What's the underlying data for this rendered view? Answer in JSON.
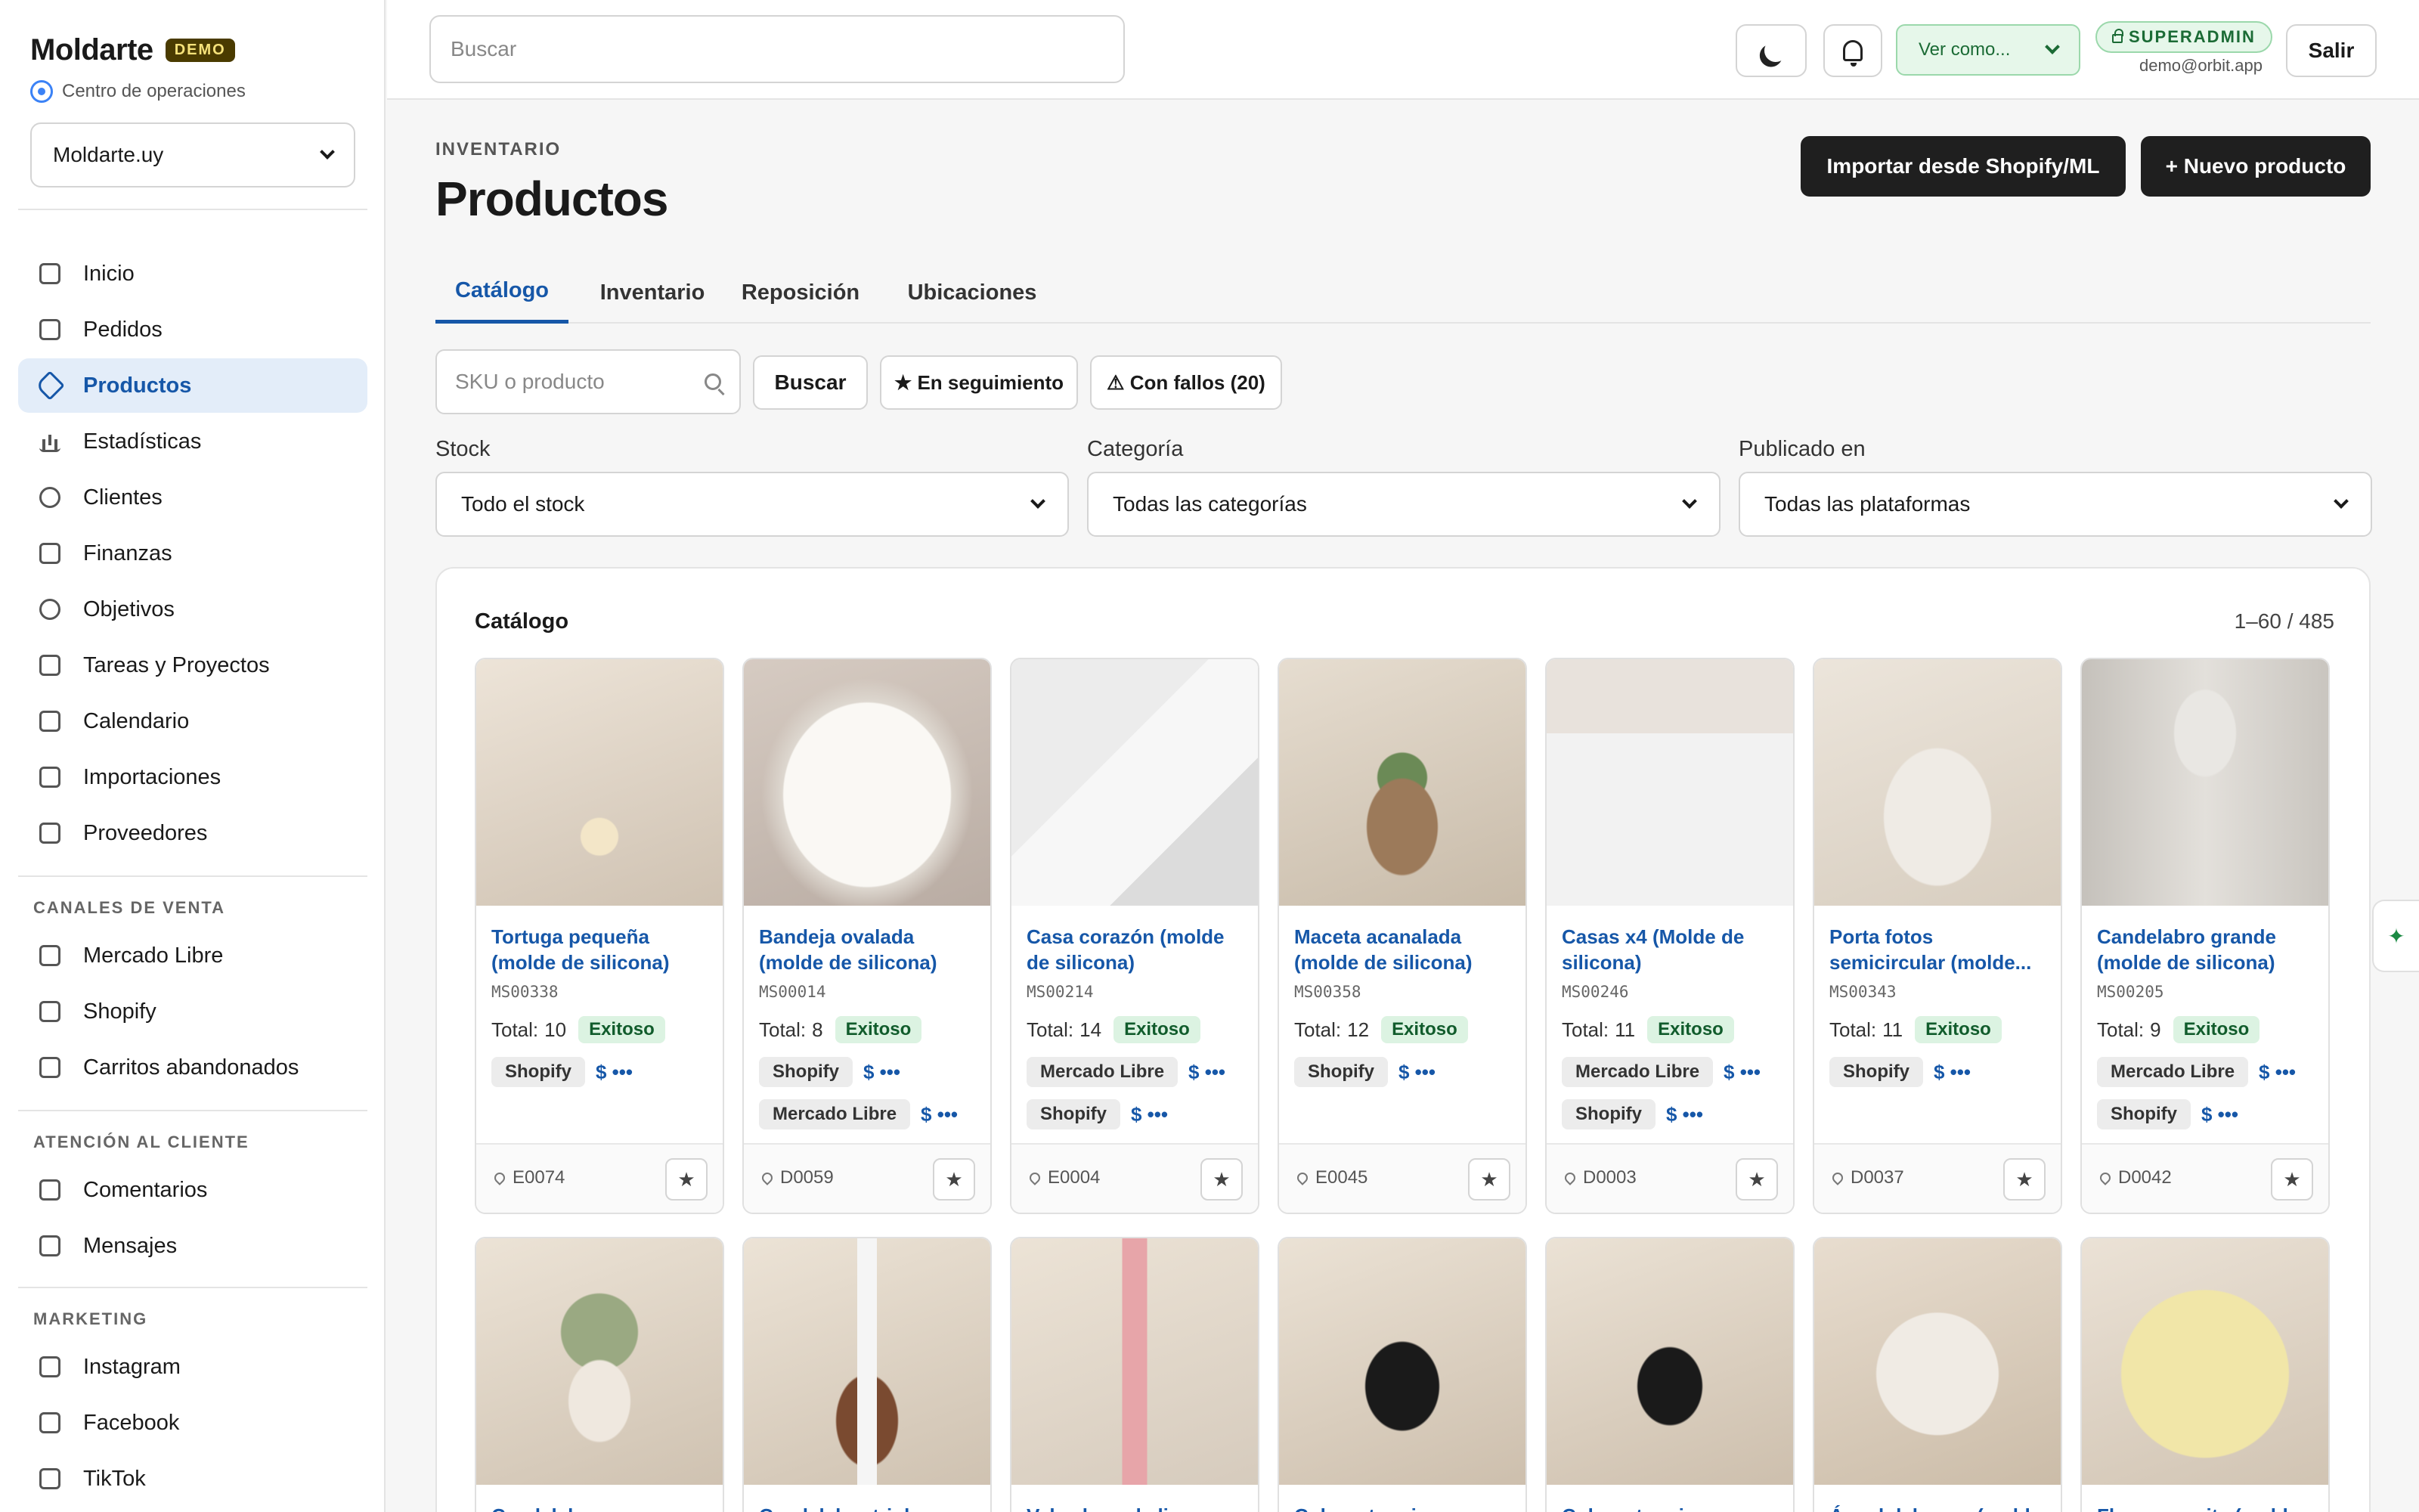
{
  "brand": {
    "name": "Moldarte",
    "badge": "DEMO",
    "subtitle": "Centro de operaciones",
    "store": "Moldarte.uy"
  },
  "sidebar": {
    "main": [
      {
        "label": "Inicio",
        "icon": "home-icon"
      },
      {
        "label": "Pedidos",
        "icon": "inbox-icon"
      },
      {
        "label": "Productos",
        "icon": "tag-icon",
        "active": true
      },
      {
        "label": "Estadísticas",
        "icon": "bar-chart-icon"
      },
      {
        "label": "Clientes",
        "icon": "user-icon"
      },
      {
        "label": "Finanzas",
        "icon": "wallet-icon"
      },
      {
        "label": "Objetivos",
        "icon": "target-icon"
      },
      {
        "label": "Tareas y Proyectos",
        "icon": "clipboard-icon"
      },
      {
        "label": "Calendario",
        "icon": "calendar-icon"
      },
      {
        "label": "Importaciones",
        "icon": "import-icon"
      },
      {
        "label": "Proveedores",
        "icon": "supplier-icon"
      }
    ],
    "sections": [
      {
        "title": "CANALES DE VENTA",
        "items": [
          {
            "label": "Mercado Libre",
            "icon": "store-icon"
          },
          {
            "label": "Shopify",
            "icon": "store-icon"
          },
          {
            "label": "Carritos abandonados",
            "icon": "inbox-icon"
          }
        ]
      },
      {
        "title": "ATENCIÓN AL CLIENTE",
        "items": [
          {
            "label": "Comentarios",
            "icon": "chat-icon"
          },
          {
            "label": "Mensajes",
            "icon": "chat-icon"
          }
        ]
      },
      {
        "title": "MARKETING",
        "items": [
          {
            "label": "Instagram",
            "icon": "store-icon"
          },
          {
            "label": "Facebook",
            "icon": "store-icon"
          },
          {
            "label": "TikTok",
            "icon": "store-icon"
          }
        ]
      }
    ]
  },
  "topbar": {
    "search_placeholder": "Buscar",
    "view_as": "Ver como...",
    "role": "SUPERADMIN",
    "email": "demo@orbit.app",
    "logout": "Salir"
  },
  "page": {
    "eyebrow": "INVENTARIO",
    "title": "Productos",
    "import_button": "Importar desde Shopify/ML",
    "new_button": "+ Nuevo producto",
    "tabs": [
      {
        "label": "Catálogo",
        "active": true
      },
      {
        "label": "Inventario"
      },
      {
        "label": "Reposición"
      },
      {
        "label": "Ubicaciones"
      }
    ]
  },
  "filters": {
    "sku_placeholder": "SKU o producto",
    "search_button": "Buscar",
    "following_button": "★ En seguimiento",
    "failed_button": "⚠ Con fallos (20)",
    "stock_label": "Stock",
    "stock_value": "Todo el stock",
    "category_label": "Categoría",
    "category_value": "Todas las categorías",
    "published_label": "Publicado en",
    "published_value": "Todas las plataformas"
  },
  "catalog": {
    "title": "Catálogo",
    "count": "1–60 / 485",
    "total_prefix": "Total:",
    "price_label": "$ •••",
    "products": [
      {
        "name": "Tortuga pequeña (molde de silicona)",
        "sku": "MS00338",
        "total": "10",
        "status": "Exitoso",
        "platforms": [
          "Shopify"
        ],
        "location": "E0074"
      },
      {
        "name": "Bandeja ovalada (molde de silicona)",
        "sku": "MS00014",
        "total": "8",
        "status": "Exitoso",
        "platforms": [
          "Shopify",
          "Mercado Libre"
        ],
        "location": "D0059"
      },
      {
        "name": "Casa corazón (molde de silicona)",
        "sku": "MS00214",
        "total": "14",
        "status": "Exitoso",
        "platforms": [
          "Mercado Libre",
          "Shopify"
        ],
        "location": "E0004"
      },
      {
        "name": "Maceta acanalada (molde de silicona)",
        "sku": "MS00358",
        "total": "12",
        "status": "Exitoso",
        "platforms": [
          "Shopify"
        ],
        "location": "E0045"
      },
      {
        "name": "Casas x4 (Molde de silicona)",
        "sku": "MS00246",
        "total": "11",
        "status": "Exitoso",
        "platforms": [
          "Mercado Libre",
          "Shopify"
        ],
        "location": "D0003"
      },
      {
        "name": "Porta fotos semicircular (molde...",
        "sku": "MS00343",
        "total": "11",
        "status": "Exitoso",
        "platforms": [
          "Shopify"
        ],
        "location": "D0037"
      },
      {
        "name": "Candelabro grande (molde de silicona)",
        "sku": "MS00205",
        "total": "9",
        "status": "Exitoso",
        "platforms": [
          "Mercado Libre",
          "Shopify"
        ],
        "location": "D0042"
      }
    ],
    "row2": [
      {
        "name": "Candelabro"
      },
      {
        "name": "Candelabro triple ore"
      },
      {
        "name": "Vela alargada lisa"
      },
      {
        "name": "Colorante rojo"
      },
      {
        "name": "Colorante gris"
      },
      {
        "name": "Ángel del amor (molde"
      },
      {
        "name": "Flor margarita (molde"
      }
    ]
  },
  "colors": {
    "accent": "#1657a8",
    "success_bg": "#dcf3e2",
    "success_text": "#115c2c",
    "dark_button": "#1f1f1f"
  }
}
